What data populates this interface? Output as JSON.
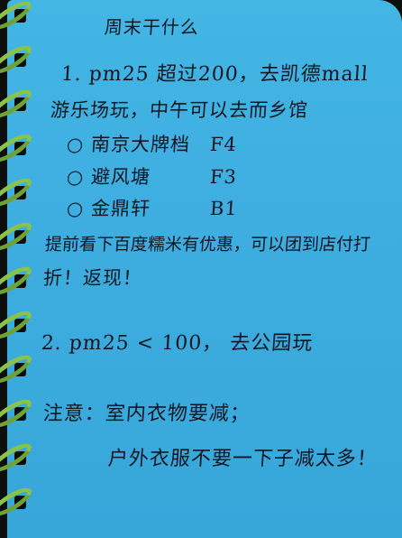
{
  "note": {
    "title": "周末干什么",
    "lines": [
      "1. pm25 超过200，去凯德mall",
      "游乐场玩，中午可以去而乡馆",
      "○ 南京大牌档　F4",
      "○ 避风塘　　　F3",
      "○ 金鼎轩　　　B1",
      "提前看下百度糯米有优惠，可以团到店付打",
      "折！返现！",
      "2. pm25 < 100， 去公园玩",
      "注意：室内衣物要减；",
      "户外衣服不要一下子减太多！"
    ]
  }
}
